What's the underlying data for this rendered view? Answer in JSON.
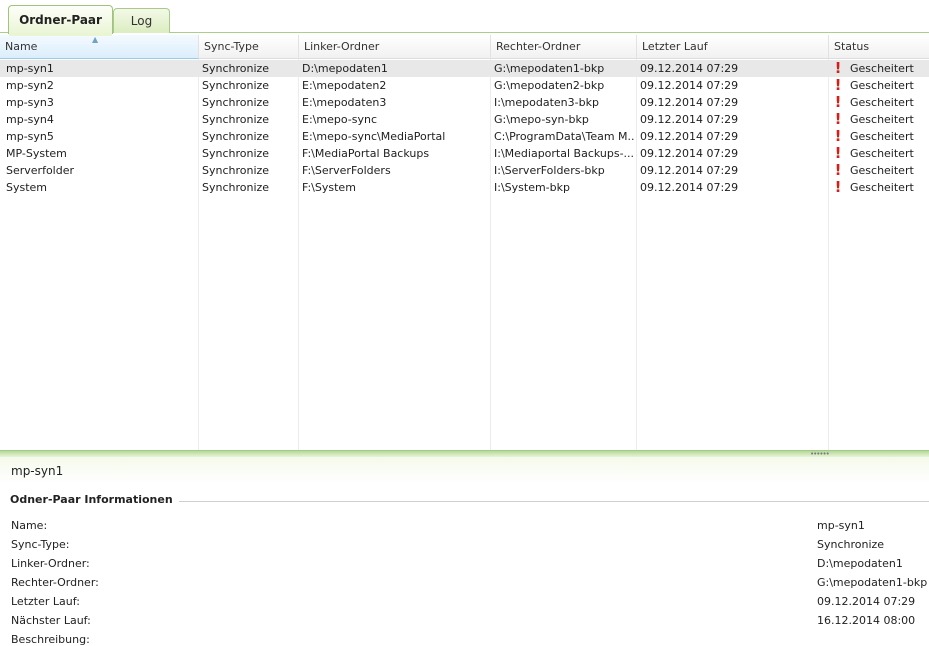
{
  "tabs": [
    {
      "label": "Ordner-Paar"
    },
    {
      "label": "Log"
    }
  ],
  "grid": {
    "columns": [
      "Name",
      "Sync-Type",
      "Linker-Ordner",
      "Rechter-Ordner",
      "Letzter Lauf",
      "Status"
    ],
    "rows": [
      {
        "name": "mp-syn1",
        "type": "Synchronize",
        "left": "D:\\mepodaten1",
        "right": "G:\\mepodaten1-bkp",
        "last": "09.12.2014 07:29",
        "status": "Gescheitert"
      },
      {
        "name": "mp-syn2",
        "type": "Synchronize",
        "left": "E:\\mepodaten2",
        "right": "G:\\mepodaten2-bkp",
        "last": "09.12.2014 07:29",
        "status": "Gescheitert"
      },
      {
        "name": "mp-syn3",
        "type": "Synchronize",
        "left": "E:\\mepodaten3",
        "right": "I:\\mepodaten3-bkp",
        "last": "09.12.2014 07:29",
        "status": "Gescheitert"
      },
      {
        "name": "mp-syn4",
        "type": "Synchronize",
        "left": "E:\\mepo-sync",
        "right": "G:\\mepo-syn-bkp",
        "last": "09.12.2014 07:29",
        "status": "Gescheitert"
      },
      {
        "name": "mp-syn5",
        "type": "Synchronize",
        "left": "E:\\mepo-sync\\MediaPortal",
        "right": "C:\\ProgramData\\Team M...",
        "last": "09.12.2014 07:29",
        "status": "Gescheitert"
      },
      {
        "name": "MP-System",
        "type": "Synchronize",
        "left": "F:\\MediaPortal Backups",
        "right": "I:\\Mediaportal Backups-...",
        "last": "09.12.2014 07:29",
        "status": "Gescheitert"
      },
      {
        "name": "Serverfolder",
        "type": "Synchronize",
        "left": "F:\\ServerFolders",
        "right": "I:\\ServerFolders-bkp",
        "last": "09.12.2014 07:29",
        "status": "Gescheitert"
      },
      {
        "name": "System",
        "type": "Synchronize",
        "left": "F:\\System",
        "right": "I:\\System-bkp",
        "last": "09.12.2014 07:29",
        "status": "Gescheitert"
      }
    ]
  },
  "detail": {
    "title": "mp-syn1",
    "group_header": "Odner-Paar Informationen",
    "fields": [
      {
        "label": "Name:",
        "value": "mp-syn1"
      },
      {
        "label": "Sync-Type:",
        "value": "Synchronize"
      },
      {
        "label": "Linker-Ordner:",
        "value": "D:\\mepodaten1"
      },
      {
        "label": "Rechter-Ordner:",
        "value": "G:\\mepodaten1-bkp"
      },
      {
        "label": "Letzter Lauf:",
        "value": "09.12.2014 07:29"
      },
      {
        "label": "Nächster Lauf:",
        "value": "16.12.2014 08:00"
      },
      {
        "label": "Beschreibung:",
        "value": ""
      }
    ]
  },
  "icons": {
    "status": "error-exclamation-icon",
    "sort": "sort-ascending-icon",
    "splitter": "splitter-grip-icon"
  },
  "colors": {
    "accent": "#a9cf8a",
    "error": "#d0201a",
    "selected_row": "#e8e8e8"
  }
}
